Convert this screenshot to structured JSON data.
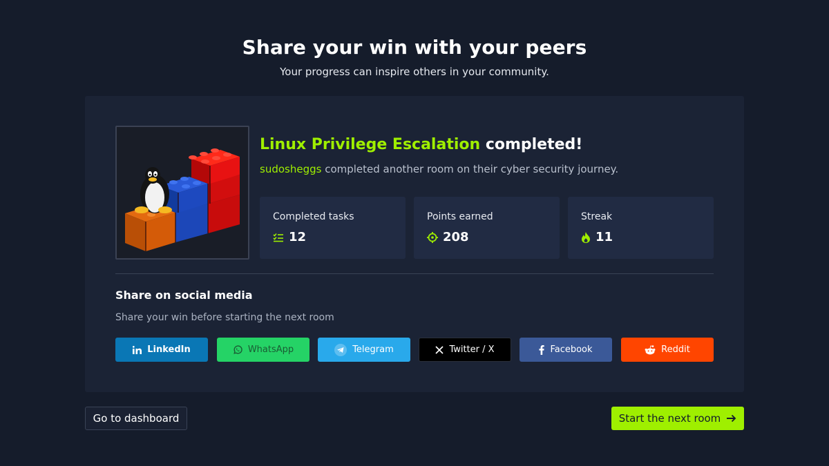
{
  "header": {
    "title": "Share your win with your peers",
    "subtitle": "Your progress can inspire others in your community."
  },
  "room": {
    "name": "Linux Privilege Escalation",
    "completed_suffix": " completed!",
    "username": "sudosheggs",
    "message": " completed another room on their cyber security journey.",
    "image_icon": "lego-blocks-with-penguin-icon"
  },
  "stats": [
    {
      "label": "Completed tasks",
      "value": "12",
      "icon": "checklist-icon"
    },
    {
      "label": "Points earned",
      "value": "208",
      "icon": "crosshair-icon"
    },
    {
      "label": "Streak",
      "value": "11",
      "icon": "flame-icon"
    }
  ],
  "share": {
    "title": "Share on social media",
    "subtitle": "Share your win before starting the next room",
    "buttons": [
      {
        "label": "LinkedIn",
        "icon": "linkedin-icon",
        "color": "#0a77b5"
      },
      {
        "label": "WhatsApp",
        "icon": "whatsapp-icon",
        "color": "#25d366"
      },
      {
        "label": "Telegram",
        "icon": "telegram-icon",
        "color": "#29a9eb"
      },
      {
        "label": "Twitter / X",
        "icon": "x-icon",
        "color": "#000000"
      },
      {
        "label": "Facebook",
        "icon": "facebook-icon",
        "color": "#3b5998"
      },
      {
        "label": "Reddit",
        "icon": "reddit-icon",
        "color": "#ff4500"
      }
    ]
  },
  "footer": {
    "dashboard_label": "Go to dashboard",
    "next_label": "Start the next room",
    "next_icon": "arrow-right-icon"
  },
  "colors": {
    "background": "#151c2b",
    "card": "#1b2335",
    "stat_card": "#212b43",
    "accent": "#9fef00"
  }
}
